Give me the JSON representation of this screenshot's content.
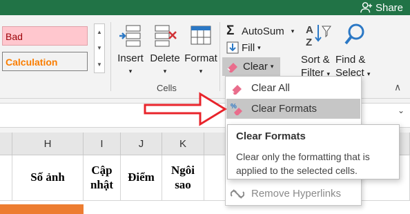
{
  "titlebar": {
    "share_label": "Share",
    "share_icon": "person-add-icon"
  },
  "styles": {
    "bad_label": "Bad",
    "calculation_label": "Calculation",
    "colors": {
      "bad_bg": "#ffc7ce",
      "bad_text": "#9c0006",
      "calc_text": "#fa7d00"
    }
  },
  "cells_group": {
    "label": "Cells",
    "insert_label": "Insert",
    "delete_label": "Delete",
    "format_label": "Format"
  },
  "editing": {
    "autosum_label": "AutoSum",
    "fill_label": "Fill",
    "clear_label": "Clear",
    "sort_label_1": "Sort &",
    "sort_label_2": "Filter",
    "find_label_1": "Find &",
    "find_label_2": "Select"
  },
  "menu": {
    "items": [
      {
        "label": "Clear All",
        "icon": "eraser-icon"
      },
      {
        "label": "Clear Formats",
        "icon": "clear-formats-icon"
      },
      {
        "label": "Remove Hyperlinks",
        "icon": "unlink-icon"
      }
    ]
  },
  "tooltip": {
    "title": "Clear Formats",
    "description": "Clear only the formatting that is applied to the selected cells."
  },
  "grid": {
    "columns": [
      "H",
      "I",
      "J",
      "K"
    ],
    "headers": [
      "Số ảnh",
      "Cập nhật",
      "Điểm",
      "Ngôi sao"
    ]
  },
  "accent_colors": {
    "excel_green": "#217346",
    "highlight_row": "#ed7d31",
    "arrow_red": "#e8242b"
  }
}
